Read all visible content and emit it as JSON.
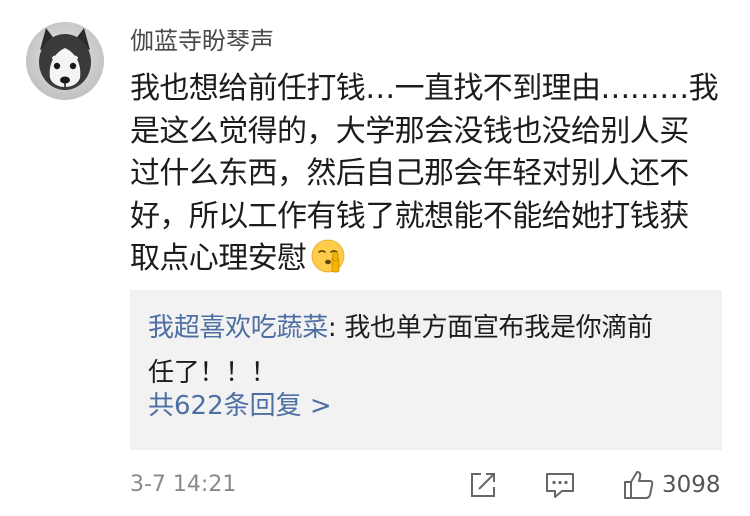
{
  "comment": {
    "username": "伽蓝寺盼琴声",
    "content_lines": [
      "我也想给前任打钱…一直找不到理由………我",
      "是这么觉得的，大学那会没钱也没给别人买",
      "过什么东西，然后自己那会年轻对别人还不",
      "好，所以工作有钱了就想能不能给她打钱获",
      "取点心理安慰"
    ],
    "emoji": "shushing-face",
    "avatar": "husky-dog-avatar"
  },
  "reply": {
    "username": "我超喜欢吃蔬菜",
    "separator": ": ",
    "text_line1": "我也单方面宣布我是你滴前",
    "text_line2": "任了！！！",
    "count_label": "共622条回复 >"
  },
  "meta": {
    "timestamp": "3-7 14:21",
    "like_count": "3098"
  },
  "icons": {
    "share": "share-icon",
    "reply": "comment-icon",
    "like": "thumbs-up-icon"
  },
  "colors": {
    "link_blue": "#4d6fa3",
    "reply_bg": "#f2f2f2",
    "meta_gray": "#8a8a8a"
  }
}
